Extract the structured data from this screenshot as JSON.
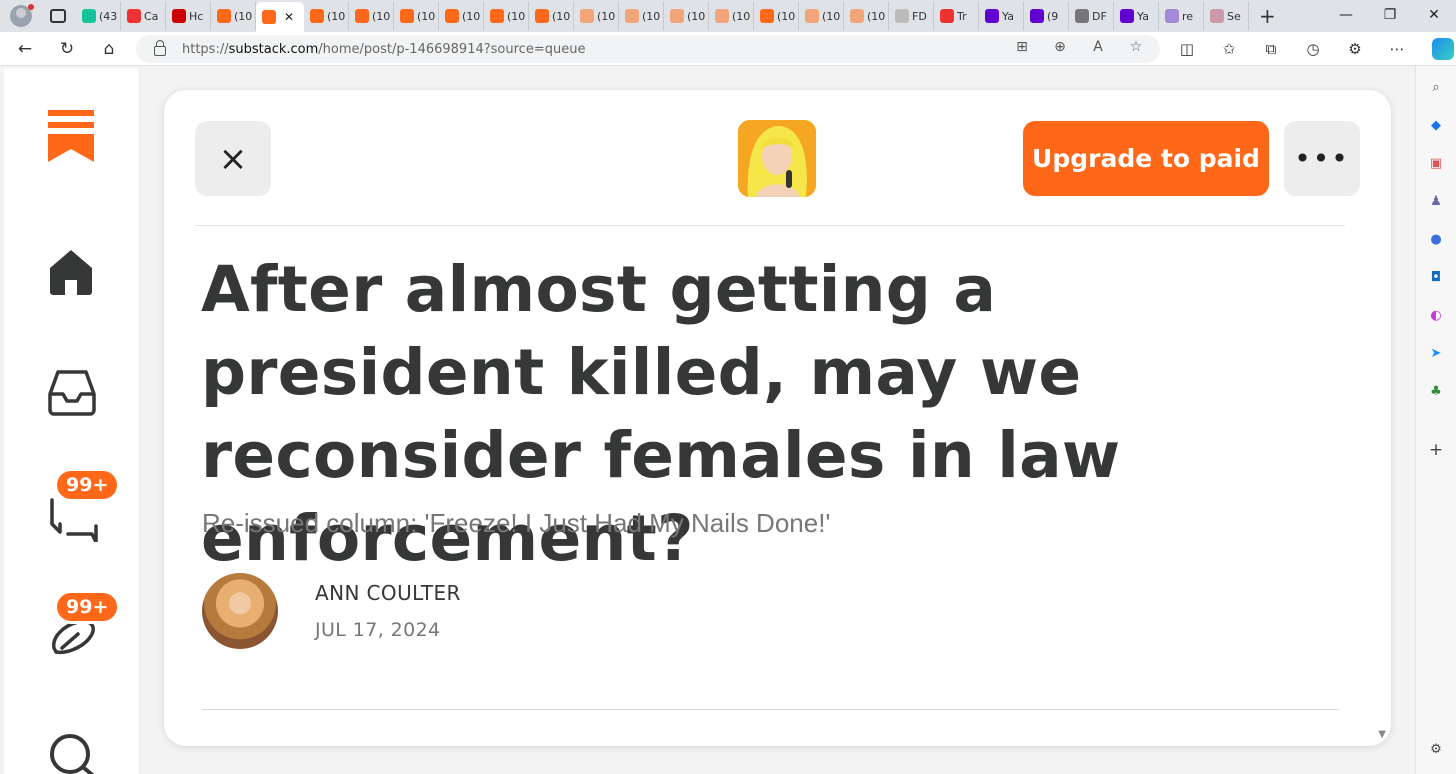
{
  "browser": {
    "tabs": [
      {
        "label": "",
        "icon": "avatar-icon"
      },
      {
        "label": "(43",
        "icon": "grammarly-icon",
        "color": "#15c39a"
      },
      {
        "label": "Ca",
        "icon": "youtube-icon",
        "color": "#e33"
      },
      {
        "label": "Hc",
        "icon": "news-icon",
        "color": "#c00"
      },
      {
        "label": "(10",
        "icon": "substack-icon",
        "color": "#ff6719"
      },
      {
        "label": "",
        "icon": "substack-icon",
        "color": "#ff6719",
        "active": true
      },
      {
        "label": "(10",
        "icon": "substack-icon",
        "color": "#ff6719"
      },
      {
        "label": "(10",
        "icon": "substack-icon",
        "color": "#ff6719"
      },
      {
        "label": "(10",
        "icon": "substack-icon",
        "color": "#ff6719"
      },
      {
        "label": "(10",
        "icon": "substack-icon",
        "color": "#ff6719"
      },
      {
        "label": "(10",
        "icon": "substack-icon",
        "color": "#ff6719"
      },
      {
        "label": "(10",
        "icon": "substack-icon",
        "color": "#ff6719"
      },
      {
        "label": "(10",
        "icon": "substack-icon",
        "color": "#f2a57a"
      },
      {
        "label": "(10",
        "icon": "substack-icon",
        "color": "#f2a57a"
      },
      {
        "label": "(10",
        "icon": "substack-icon",
        "color": "#f2a57a"
      },
      {
        "label": "(10",
        "icon": "substack-icon",
        "color": "#f2a57a"
      },
      {
        "label": "(10",
        "icon": "substack-icon",
        "color": "#ff6719"
      },
      {
        "label": "(10",
        "icon": "substack-icon",
        "color": "#f2a57a"
      },
      {
        "label": "(10",
        "icon": "substack-icon",
        "color": "#f2a57a"
      },
      {
        "label": "FD",
        "icon": "document-icon",
        "color": "#bbb"
      },
      {
        "label": "Tr",
        "icon": "youtube-icon",
        "color": "#e33"
      },
      {
        "label": "Ya",
        "icon": "yahoo-icon",
        "color": "#6001d2"
      },
      {
        "label": "(9",
        "icon": "mail-icon",
        "color": "#6001d2"
      },
      {
        "label": "DF",
        "icon": "slash-icon",
        "color": "#777"
      },
      {
        "label": "Ya",
        "icon": "yahoo-icon",
        "color": "#6001d2"
      },
      {
        "label": "re",
        "icon": "yahoo-icon",
        "color": "#a48ad6"
      },
      {
        "label": "Se",
        "icon": "image-icon",
        "color": "#c9a"
      }
    ],
    "url_prefix": "https://",
    "url_domain": "substack.com",
    "url_path": "/home/post/p-146698914?source=queue"
  },
  "rail": {
    "inbox_badge": "99+",
    "chat_badge": "99+"
  },
  "post": {
    "close_label": "×",
    "upgrade_label": "Upgrade to paid",
    "more_label": "•••",
    "title": "After almost getting a president killed, may we reconsider females in law enforcement?",
    "subtitle": "Re-issued column: 'Freeze! I Just Had My Nails Done!'",
    "author": "ANN COULTER",
    "date": "JUL 17, 2024"
  },
  "colors": {
    "brand": "#ff6719",
    "text": "#363737"
  }
}
